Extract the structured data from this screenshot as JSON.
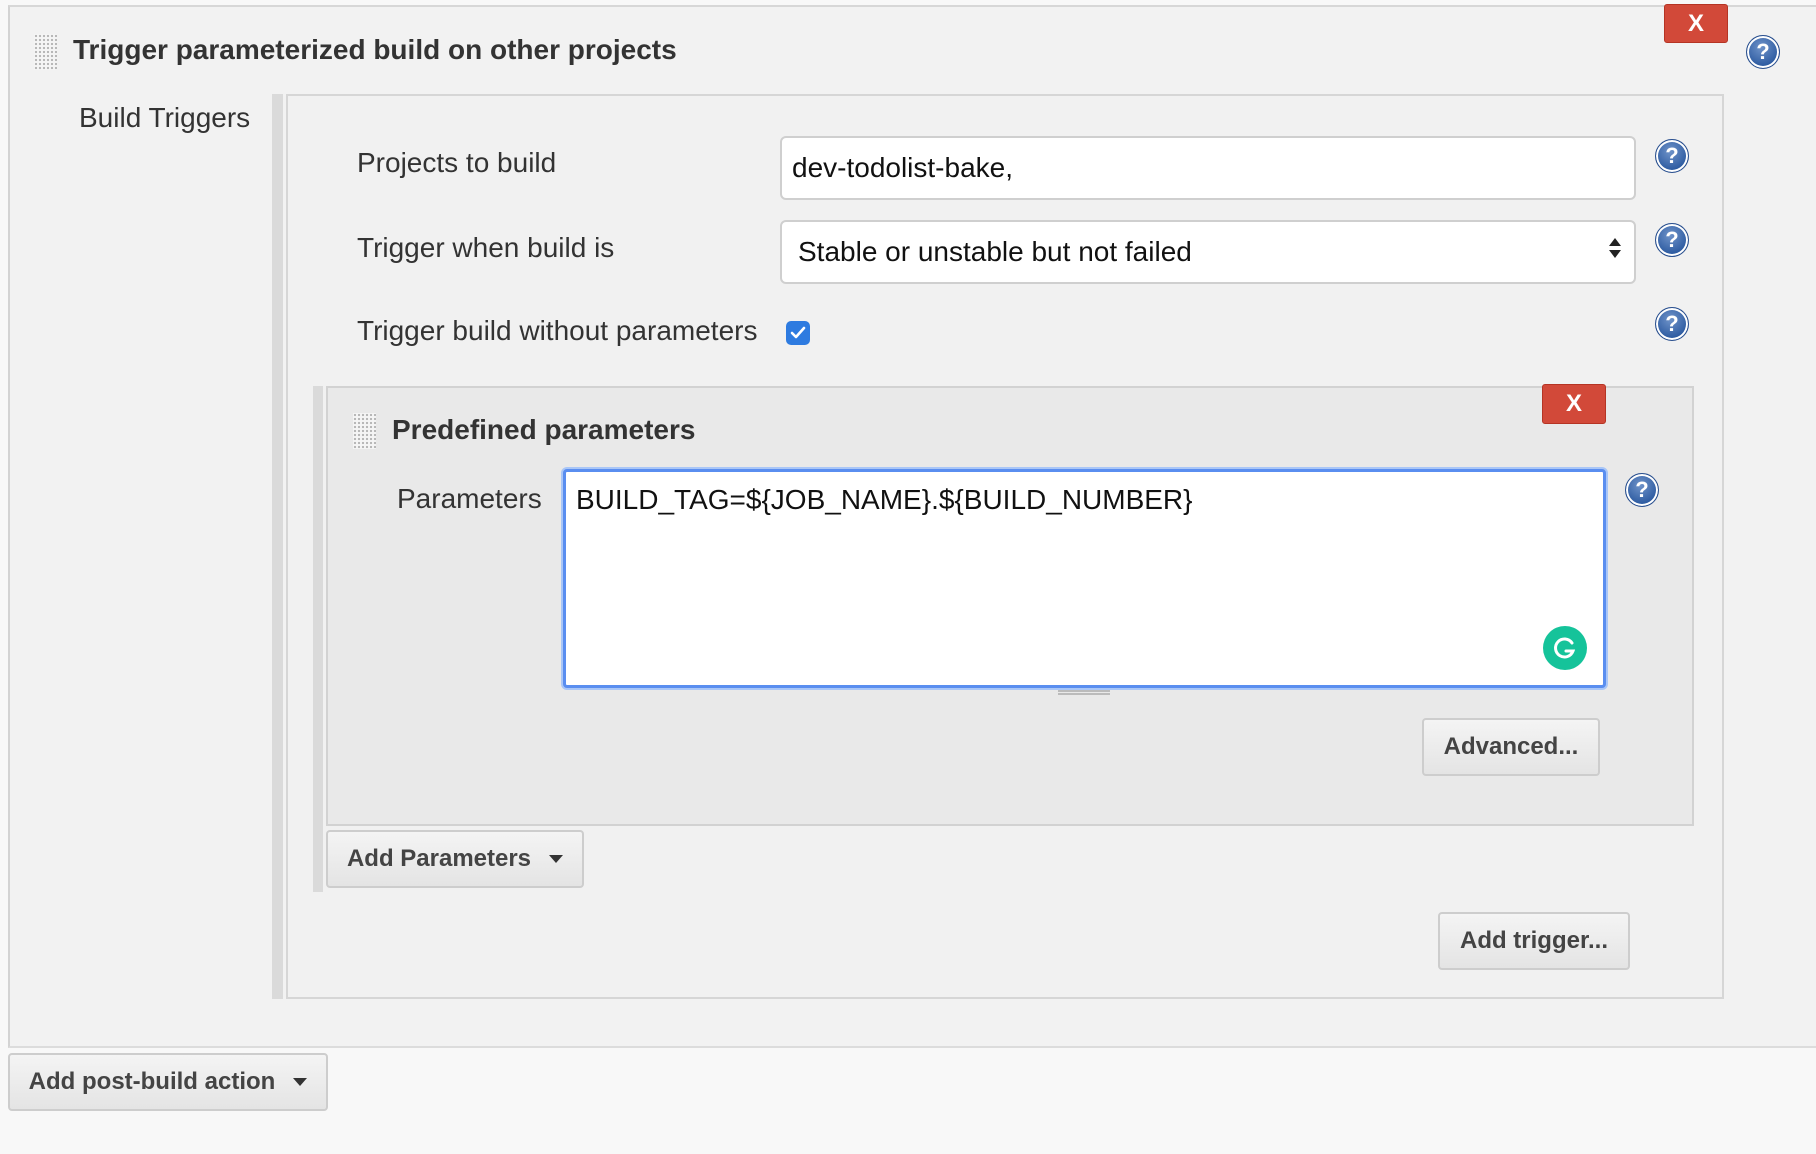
{
  "step": {
    "title": "Trigger parameterized build on other projects",
    "delete_label": "X",
    "section_label": "Build Triggers"
  },
  "trigger": {
    "projects_label": "Projects to build",
    "projects_value": "dev-todolist-bake,",
    "when_label": "Trigger when build is",
    "when_value": "Stable or unstable but not failed",
    "without_params_label": "Trigger build without parameters",
    "without_params_checked": true,
    "add_parameters_label": "Add Parameters",
    "add_trigger_label": "Add trigger..."
  },
  "predefined": {
    "title": "Predefined parameters",
    "delete_label": "X",
    "parameters_label": "Parameters",
    "parameters_value": "BUILD_TAG=${JOB_NAME}.${BUILD_NUMBER}",
    "advanced_label": "Advanced..."
  },
  "footer": {
    "add_post_build_label": "Add post-build action"
  },
  "help_glyph": "?",
  "icons": {
    "help": "question-circle-icon",
    "drag": "drag-handle-icon",
    "dropdown": "caret-down-icon",
    "check": "checkmark-icon",
    "grammarly": "grammarly-icon"
  },
  "colors": {
    "delete_button": "#d24939",
    "help_icon": "#2c5aa0",
    "focus_border": "#5a8ef0",
    "checkbox": "#2e7be0",
    "grammarly": "#15c39a"
  }
}
